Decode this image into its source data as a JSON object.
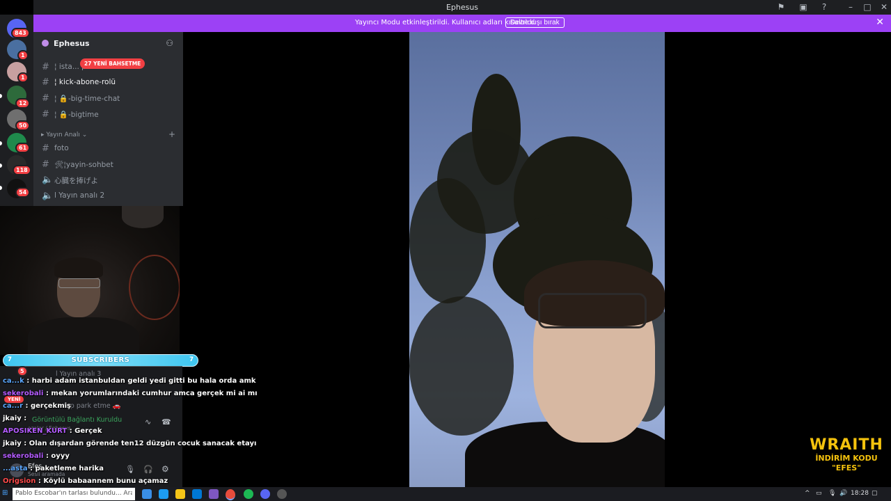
{
  "window": {
    "title": "Ephesus"
  },
  "banner": {
    "message": "Yayıncı Modu etkinleştirildi. Kullanıcı adları kısaltıldı.",
    "button": "Devre dışı bırak"
  },
  "rail": {
    "badges": [
      "843",
      "1",
      "1",
      "12",
      "50",
      "61",
      "118",
      "54"
    ]
  },
  "server": {
    "name": "Ephesus"
  },
  "mention_pill": "27 YENİ BAHSETME",
  "channels": {
    "c1": "¦ ista... pleri",
    "c2": "¦ kick-abone-rolü",
    "c3": "¦ 🔒-big-time-chat",
    "c4": "¦ 🔒-bigtime",
    "category": "Yayın Analı",
    "c5": "foto",
    "c6": "🛠¦yayin-sohbet",
    "c7": "心臓を捧げよ",
    "c8": "l Yayın analı 2"
  },
  "subscribers": {
    "title": "SUBSCRIBERS",
    "left": "7",
    "right": "7"
  },
  "ghost": {
    "analiz3": "l Yayın analı 3",
    "parketme": "sap park etme 🚗",
    "yeni": "YENİ",
    "connected": "Görüntülü Bağlantı Kuruldu",
    "path": "azalar / Ephesus",
    "user": "Efes",
    "status": "Sesli aramada",
    "count": "5"
  },
  "chat": [
    {
      "user": "ca...k",
      "color": "#5aa7ff",
      "text": " : harbi adam istanbuldan geldi yedi gitti bu hala orda amk"
    },
    {
      "user": "sekerobali",
      "color": "#b45cff",
      "text": " : mekan yorumlarındaki cumhur amca gerçek mi ai mı"
    },
    {
      "user": "ca...r",
      "color": "#5aa7ff",
      "text": " : gerçekmiş"
    },
    {
      "user": "jkaiy",
      "color": "#ffffff",
      "text": " : "
    },
    {
      "user": "APOSIKEN_KURT",
      "color": "#b45cff",
      "text": " : Gerçek"
    },
    {
      "user": "jkaiy",
      "color": "#ffffff",
      "text": " : Olan dışardan görende ten12 düzgün cocuk sanacak etayı"
    },
    {
      "user": "sekerobali",
      "color": "#b45cff",
      "text": " : oyyy"
    },
    {
      "user": "...asta",
      "color": "#5aa7ff",
      "text": " : paketleme harika"
    },
    {
      "user": "Origsion",
      "color": "#ff4a4a",
      "text": " : Köylü babaannem bunu açamaz"
    }
  ],
  "sponsor": {
    "line1": "WRAITH",
    "line2": "İNDİRİM KODU",
    "line3": "\"EFES\""
  },
  "taskbar": {
    "search": "Pablo Escobar'ın tarlası bulundu... Aramak için buraya yazın",
    "time": "18:28"
  }
}
